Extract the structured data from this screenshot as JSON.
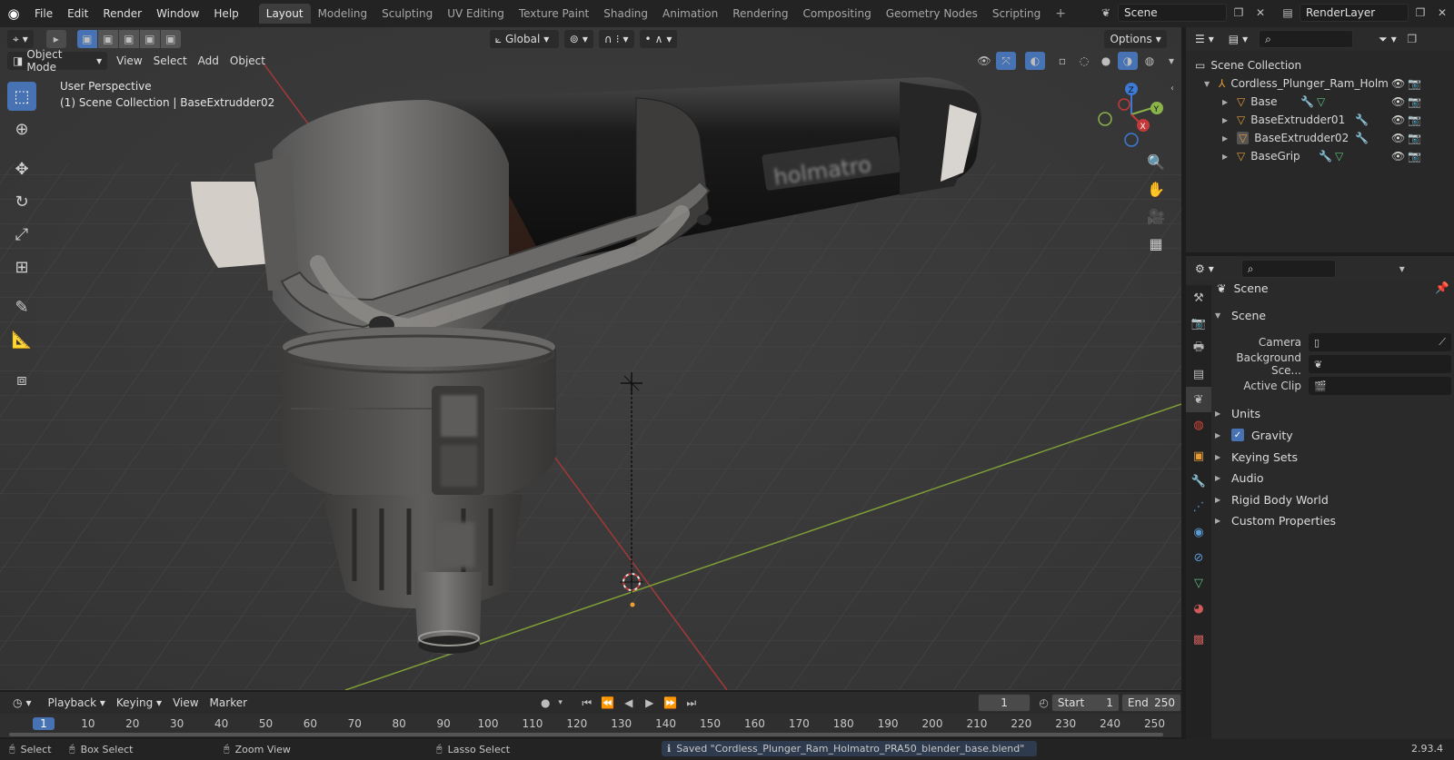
{
  "app": {
    "menu": [
      "File",
      "Edit",
      "Render",
      "Window",
      "Help"
    ],
    "workspaces": [
      "Layout",
      "Modeling",
      "Sculpting",
      "UV Editing",
      "Texture Paint",
      "Shading",
      "Animation",
      "Rendering",
      "Compositing",
      "Geometry Nodes",
      "Scripting"
    ],
    "active_workspace": "Layout",
    "scene_name": "Scene",
    "view_layer": "RenderLayer"
  },
  "viewport": {
    "transform_orientation": "Global",
    "options_label": "Options",
    "mode": "Object Mode",
    "menus": [
      "View",
      "Select",
      "Add",
      "Object"
    ],
    "info_line1": "User Perspective",
    "info_line2": "(1) Scene Collection | BaseExtrudder02",
    "gizmo_axes": [
      "Z",
      "Y",
      "X"
    ],
    "product_label_text": "holmatro"
  },
  "timeline": {
    "menus": [
      "Playback",
      "Keying",
      "View",
      "Marker"
    ],
    "current_frame": "1",
    "start_label": "Start",
    "start_value": "1",
    "end_label": "End",
    "end_value": "250",
    "ruler_ticks": [
      "1",
      "10",
      "20",
      "30",
      "40",
      "50",
      "60",
      "70",
      "80",
      "90",
      "100",
      "110",
      "120",
      "130",
      "140",
      "150",
      "160",
      "170",
      "180",
      "190",
      "200",
      "210",
      "220",
      "230",
      "240",
      "250"
    ]
  },
  "outliner": {
    "root": "Scene Collection",
    "collection": "Cordless_Plunger_Ram_Holm",
    "objects": [
      "Base",
      "BaseExtrudder01",
      "BaseExtrudder02",
      "BaseGrip"
    ]
  },
  "properties": {
    "context_name": "Scene",
    "panel_title": "Scene",
    "camera_label": "Camera",
    "background_label": "Background Sce...",
    "active_clip_label": "Active Clip",
    "sections": [
      "Units",
      "Gravity",
      "Keying Sets",
      "Audio",
      "Rigid Body World",
      "Custom Properties"
    ]
  },
  "statusbar": {
    "select": "Select",
    "box_select": "Box Select",
    "zoom_view": "Zoom View",
    "lasso_select": "Lasso Select",
    "message": "Saved \"Cordless_Plunger_Ram_Holmatro_PRA50_blender_base.blend\"",
    "version": "2.93.4"
  },
  "colors": {
    "accent": "#4772b3",
    "x_axis": "#c43a3a",
    "y_axis": "#8ab34a",
    "z_axis": "#3d7ad6",
    "object_icon": "#e69b3a",
    "mesh_data_icon": "#5fbf7d"
  }
}
